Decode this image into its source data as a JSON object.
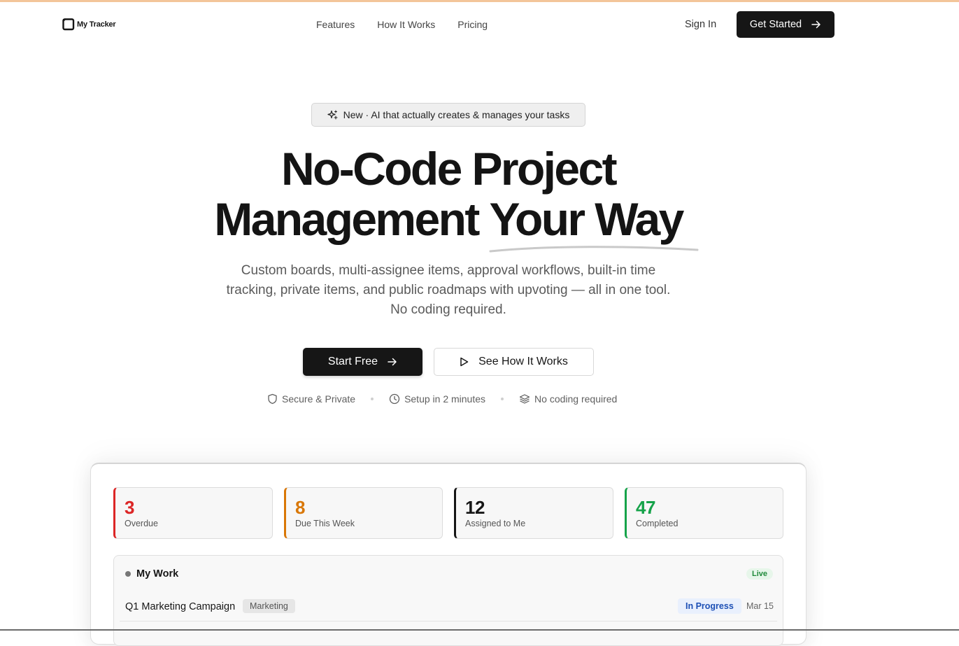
{
  "nav": {
    "brand": "My Tracker",
    "links": [
      "Features",
      "How It Works",
      "Pricing"
    ],
    "sign_in": "Sign In",
    "cta": "Get Started"
  },
  "hero": {
    "badge": "New · AI that actually creates & manages your tasks",
    "headline_line1": "No-Code Project",
    "headline_line2_a": "Management ",
    "headline_line2_b": "Your Way",
    "subtitle": "Custom boards, multi-assignee items, approval workflows, built-in time tracking, private items, and public roadmaps with upvoting — all in one tool. No coding required.",
    "primary_button": "Start Free",
    "secondary_button": "See How It Works",
    "trust": [
      {
        "label": "Secure & Private",
        "icon": "shield-icon"
      },
      {
        "label": "Setup in 2 minutes",
        "icon": "clock-icon"
      },
      {
        "label": "No coding required",
        "icon": "layers-icon"
      }
    ]
  },
  "dashboard": {
    "stats": [
      {
        "value": "3",
        "label": "Overdue",
        "color": "#dc2626"
      },
      {
        "value": "8",
        "label": "Due This Week",
        "color": "#d97706"
      },
      {
        "value": "12",
        "label": "Assigned to Me",
        "color": "#161616"
      },
      {
        "value": "47",
        "label": "Completed",
        "color": "#16a34a"
      }
    ],
    "work": {
      "title": "My Work",
      "live": "Live",
      "rows": [
        {
          "title": "Q1 Marketing Campaign",
          "tag": "Marketing",
          "status": "In Progress",
          "date": "Mar 15"
        }
      ]
    }
  },
  "colors": {
    "primary": "#161616",
    "accent_top": "#f3c59a"
  }
}
